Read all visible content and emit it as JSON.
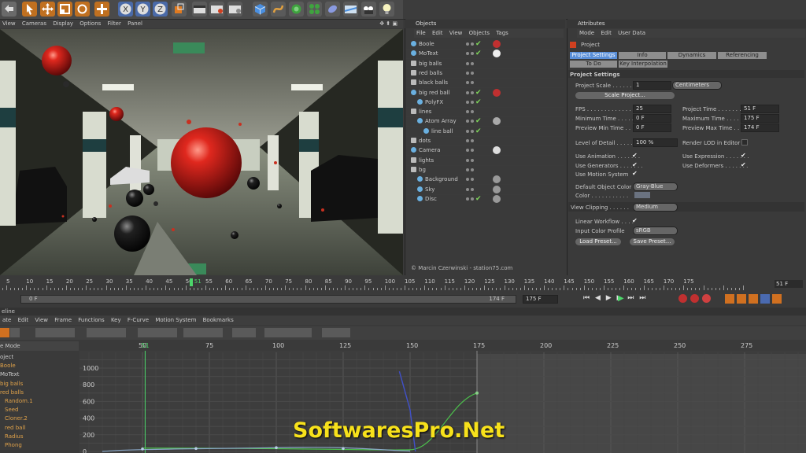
{
  "viewport": {
    "menu": [
      "View",
      "Cameras",
      "Display",
      "Options",
      "Filter",
      "Panel"
    ],
    "credit": "© Marcin Czerwinski - station75.com"
  },
  "objects": {
    "title": "Objects",
    "menu": [
      "File",
      "Edit",
      "View",
      "Objects",
      "Tags"
    ],
    "items": [
      "Boole",
      "MoText",
      "big balls",
      "red balls",
      "black balls",
      "big red ball",
      "PolyFX",
      "lines",
      "Atom Array",
      "line ball",
      "dots",
      "Camera",
      "lights",
      "bg",
      "Background",
      "Sky",
      "Disc"
    ]
  },
  "attributes": {
    "title": "Attributes",
    "menu": [
      "Mode",
      "Edit",
      "User Data"
    ],
    "object": "Project",
    "tabs": [
      "Project Settings",
      "Info",
      "Dynamics",
      "Referencing"
    ],
    "tabs2": [
      "To Do",
      "Key Interpolation"
    ],
    "section": "Project Settings",
    "project_scale_label": "Project Scale . . . . . . . .",
    "project_scale": "1",
    "project_scale_unit": "Centimeters",
    "scale_project_button": "Scale Project...",
    "fps_label": "FPS . . . . . . . . . . . . . . .",
    "fps": "25",
    "project_time_label": "Project Time . . . . . . . .",
    "project_time": "51 F",
    "min_time_label": "Minimum Time . . . . . . .",
    "min_time": "0 F",
    "max_time_label": "Maximum Time . . . . . .",
    "max_time": "175 F",
    "prev_min_label": "Preview Min Time . . . . .",
    "prev_min": "0 F",
    "prev_max_label": "Preview Max Time . . .",
    "prev_max": "174 F",
    "lod_label": "Level of Detail . . . . . .",
    "lod": "100 %",
    "render_lod_label": "Render LOD in Editor",
    "use_anim_label": "Use Animation . . . . . . .",
    "use_expr_label": "Use Expression . . . . . . .",
    "use_gen_label": "Use Generators . . . . . . .",
    "use_def_label": "Use Deformers . . . . . . .",
    "use_motion_label": "Use Motion System",
    "def_color_label": "Default Object Color",
    "def_color": "Gray-Blue",
    "color_label": "Color . . . . . . . . . . .",
    "view_clip_label": "View Clipping . . . . . .",
    "view_clip": "Medium",
    "linear_label": "Linear Workflow . . . .",
    "input_profile_label": "Input Color Profile",
    "input_profile": "sRGB",
    "load_preset": "Load Preset...",
    "save_preset": "Save Preset..."
  },
  "timeline": {
    "ticks": [
      "5",
      "10",
      "15",
      "20",
      "25",
      "30",
      "35",
      "40",
      "45",
      "50",
      "51",
      "55",
      "60",
      "65",
      "70",
      "75",
      "80",
      "85",
      "90",
      "95",
      "100",
      "105",
      "110",
      "115",
      "120",
      "125",
      "130",
      "135",
      "140",
      "145",
      "150",
      "155",
      "160",
      "165",
      "170",
      "175"
    ],
    "current": "51 F",
    "start": "0 F",
    "end": "174 F",
    "end2": "175 F"
  },
  "fcurve": {
    "title": "eline",
    "menu": [
      "ate",
      "Edit",
      "View",
      "Frame",
      "Functions",
      "Key",
      "F-Curve",
      "Motion System",
      "Bookmarks"
    ],
    "mode_label": "e Mode",
    "tracks": [
      "oject",
      "Boole",
      "MoText",
      "big balls",
      "red balls",
      "Random.1",
      "Seed",
      "Cloner.2",
      "red ball",
      "Radius",
      "Phong"
    ],
    "xticks": [
      "50",
      "75",
      "100",
      "125",
      "150",
      "175",
      "200",
      "225",
      "250",
      "275"
    ],
    "current": "51",
    "yticks": [
      "1000",
      "800",
      "600",
      "400",
      "200",
      "0"
    ]
  },
  "watermark": "SoftwaresPro.Net",
  "colors": {
    "accent": "#5a8fd8",
    "check": "#7fd85a",
    "track": "#e0a24a",
    "curve_green": "#4cc04c",
    "curve_blue": "#4050c8",
    "playhead": "#4cd66a"
  }
}
